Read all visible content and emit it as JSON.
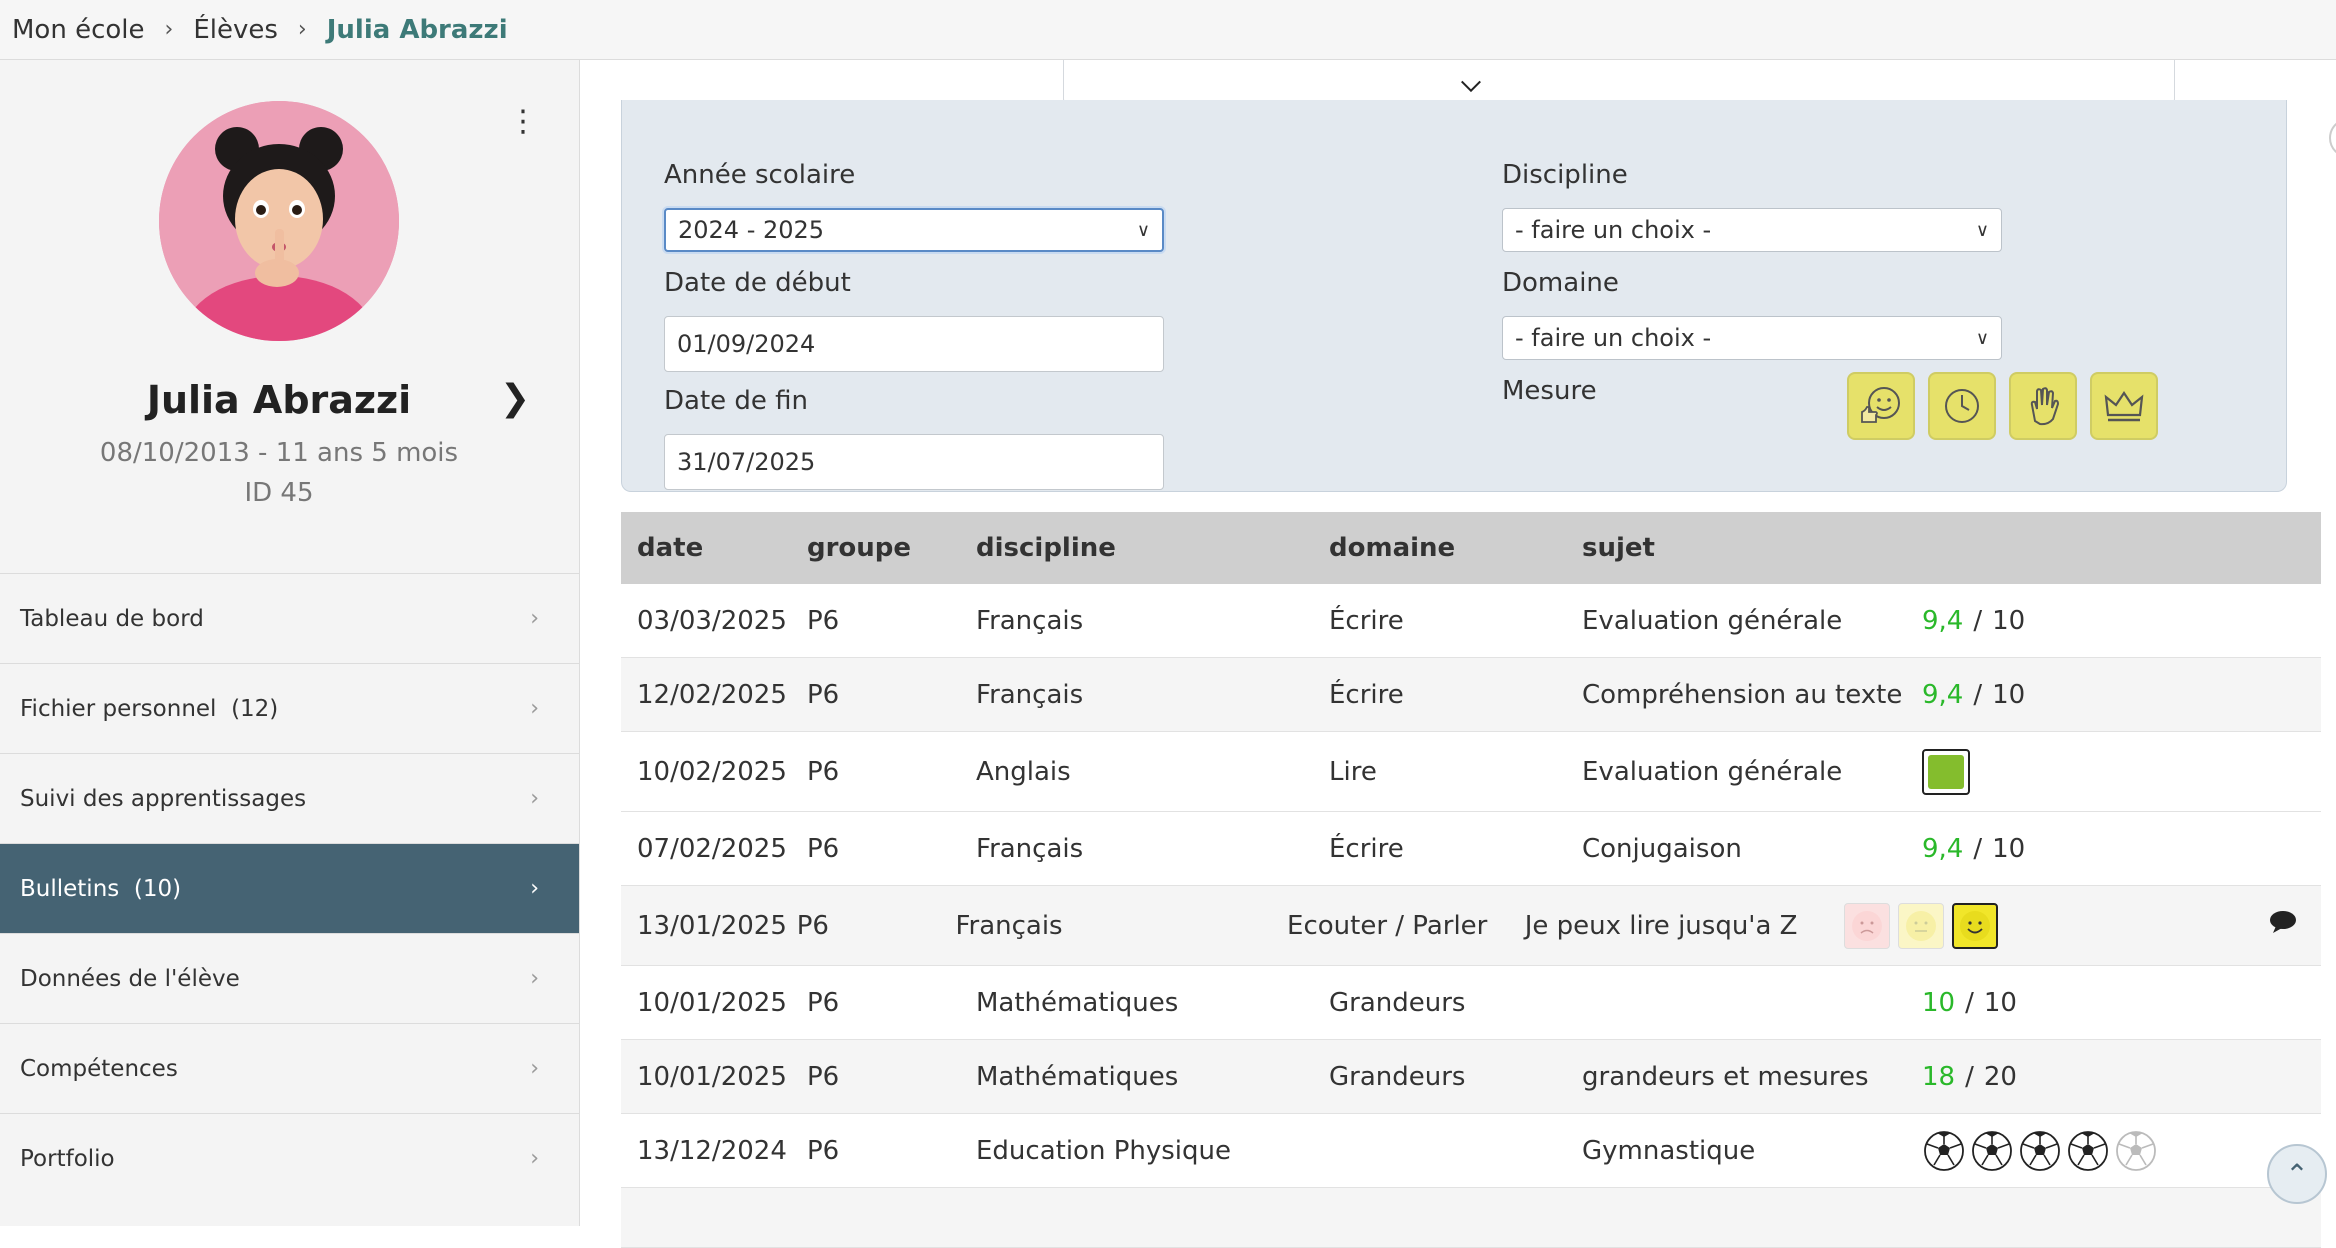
{
  "breadcrumb": {
    "home": "Mon école",
    "students": "Élèves",
    "current": "Julia Abrazzi"
  },
  "student": {
    "name": "Julia Abrazzi",
    "dob": "08/10/2013 - 11 ans 5 mois",
    "id": "ID 45"
  },
  "menu": [
    {
      "label": "Tableau de bord",
      "count": ""
    },
    {
      "label": "Fichier personnel",
      "count": "(12)"
    },
    {
      "label": "Suivi des apprentissages",
      "count": ""
    },
    {
      "label": "Bulletins",
      "count": "(10)",
      "active": true
    },
    {
      "label": "Données de l'élève",
      "count": ""
    },
    {
      "label": "Compétences",
      "count": ""
    },
    {
      "label": "Portfolio",
      "count": ""
    }
  ],
  "filters": {
    "year_label": "Année scolaire",
    "year_value": "2024 - 2025",
    "start_label": "Date de début",
    "start_value": "01/09/2024",
    "end_label": "Date de fin",
    "end_value": "31/07/2025",
    "discipline_label": "Discipline",
    "discipline_value": "- faire un choix -",
    "domain_label": "Domaine",
    "domain_value": "- faire un choix -",
    "measure_label": "Mesure",
    "measure_icons": [
      "thumbs-smiley-icon",
      "clock-icon",
      "hand-icon",
      "crown-icon"
    ]
  },
  "table": {
    "headers": {
      "date": "date",
      "group": "groupe",
      "discipline": "discipline",
      "domain": "domaine",
      "subject": "sujet"
    },
    "rows": [
      {
        "date": "03/03/2025",
        "group": "P6",
        "discipline": "Français",
        "domain": "Écrire",
        "subject": "Evaluation générale",
        "result_type": "score",
        "score": "9,4",
        "max": "10"
      },
      {
        "date": "12/02/2025",
        "group": "P6",
        "discipline": "Français",
        "domain": "Écrire",
        "subject": "Compréhension au texte",
        "result_type": "score",
        "score": "9,4",
        "max": "10"
      },
      {
        "date": "10/02/2025",
        "group": "P6",
        "discipline": "Anglais",
        "domain": "Lire",
        "subject": "Evaluation générale",
        "result_type": "color-square",
        "color": "#84bd2d"
      },
      {
        "date": "07/02/2025",
        "group": "P6",
        "discipline": "Français",
        "domain": "Écrire",
        "subject": "Conjugaison",
        "result_type": "score",
        "score": "9,4",
        "max": "10"
      },
      {
        "date": "13/01/2025",
        "group": "P6",
        "discipline": "Français",
        "domain": "Ecouter / Parler",
        "subject": "Je peux lire jusqu'a Z",
        "result_type": "smileys",
        "selected": 3,
        "comment_icon": "speech-bubble-icon"
      },
      {
        "date": "10/01/2025",
        "group": "P6",
        "discipline": "Mathématiques",
        "domain": "Grandeurs",
        "subject": "",
        "result_type": "score",
        "score": "10",
        "max": "10"
      },
      {
        "date": "10/01/2025",
        "group": "P6",
        "discipline": "Mathématiques",
        "domain": "Grandeurs",
        "subject": "grandeurs et mesures",
        "result_type": "score",
        "score": "18",
        "max": "20"
      },
      {
        "date": "13/12/2024",
        "group": "P6",
        "discipline": "Education Physique",
        "domain": "",
        "subject": "Gymnastique",
        "result_type": "balls",
        "filled": 4,
        "total": 5
      }
    ]
  },
  "colors": {
    "accent": "#3d7a78",
    "active_menu": "#456373",
    "score_green": "#2ab82a",
    "measure_yellow": "#e6e16a"
  }
}
